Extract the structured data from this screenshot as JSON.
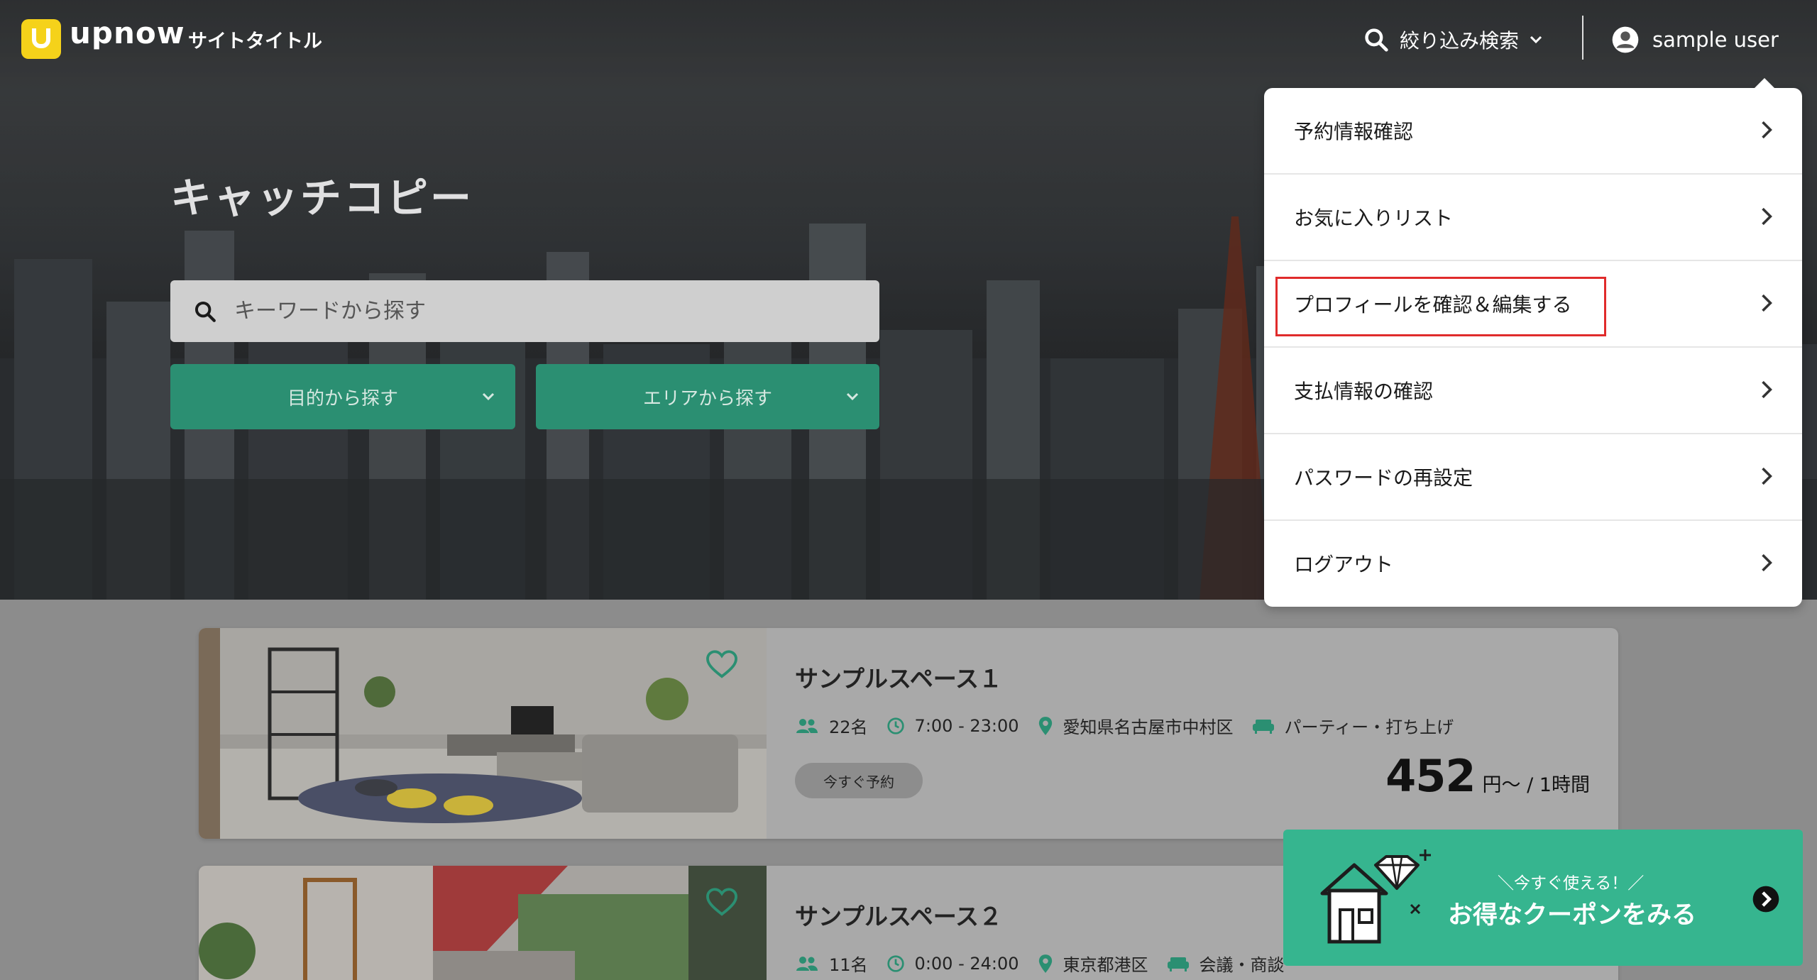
{
  "header": {
    "logo_text": "upnow",
    "site_title": "サイトタイトル",
    "filter_label": "絞り込み検索",
    "user_name": "sample user"
  },
  "hero": {
    "catch_copy": "キャッチコピー",
    "search_placeholder": "キーワードから探す",
    "purpose_select": "目的から探す",
    "area_select": "エリアから探す"
  },
  "user_menu": {
    "items": [
      {
        "label": "予約情報確認"
      },
      {
        "label": "お気に入りリスト"
      },
      {
        "label": "プロフィールを確認＆編集する",
        "highlighted": true
      },
      {
        "label": "支払情報の確認"
      },
      {
        "label": "パスワードの再設定"
      },
      {
        "label": "ログアウト"
      }
    ],
    "highlight_color": "#e02b2b"
  },
  "listings": [
    {
      "title": "サンプルスペース１",
      "capacity": "22名",
      "hours": "7:00 - 23:00",
      "location": "愛知県名古屋市中村区",
      "purpose": "パーティー・打ち上げ",
      "reserve_label": "今すぐ予約",
      "price": "452",
      "price_unit": "円〜 / 1時間"
    },
    {
      "title": "サンプルスペース２",
      "capacity": "11名",
      "hours": "0:00 - 24:00",
      "location": "東京都港区",
      "purpose": "会議・商談"
    }
  ],
  "coupon": {
    "tagline": "＼今すぐ使える！／",
    "label": "お得なクーポンをみる"
  },
  "colors": {
    "accent": "#2b8f72",
    "coupon": "#36b58f",
    "logo": "#f5d21a"
  }
}
